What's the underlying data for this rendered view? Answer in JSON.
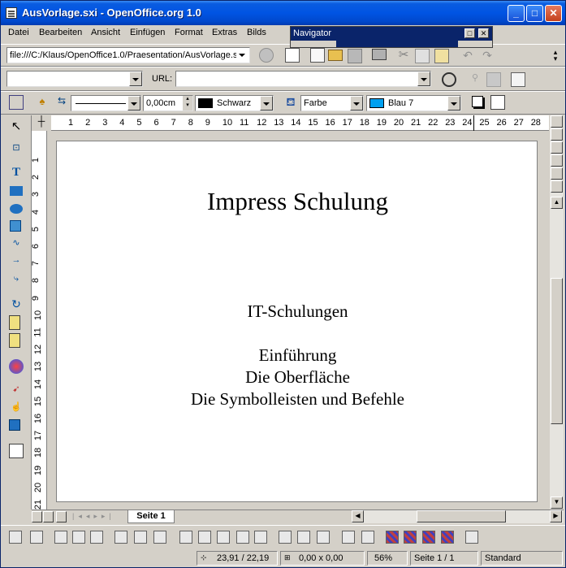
{
  "window": {
    "title": "AusVorlage.sxi - OpenOffice.org 1.0"
  },
  "menu": [
    "Datei",
    "Bearbeiten",
    "Ansicht",
    "Einfügen",
    "Format",
    "Extras",
    "Bilds"
  ],
  "navigator": {
    "title": "Navigator"
  },
  "toolbar1": {
    "path_value": "file:///C:/Klaus/OpenOffice1.0/Praesentation/AusVorlage.s"
  },
  "toolbar2": {
    "left_value": "",
    "url_label": "URL:",
    "url_value": ""
  },
  "toolbar3": {
    "line_width": "0,00cm",
    "line_color": "Schwarz",
    "area_style": "Farbe",
    "area_color": "Blau 7",
    "line_color_hex": "#000000",
    "area_color_hex": "#00a0f0"
  },
  "hruler": [
    "1",
    "2",
    "3",
    "4",
    "5",
    "6",
    "7",
    "8",
    "9",
    "10",
    "11",
    "12",
    "13",
    "14",
    "15",
    "16",
    "17",
    "18",
    "19",
    "20",
    "21",
    "22",
    "23",
    "24",
    "25",
    "26",
    "27",
    "28"
  ],
  "vruler": [
    "1",
    "2",
    "3",
    "4",
    "5",
    "6",
    "7",
    "8",
    "9",
    "10",
    "11",
    "12",
    "13",
    "14",
    "15",
    "16",
    "17",
    "18",
    "19",
    "20",
    "21"
  ],
  "slide": {
    "title": "Impress Schulung",
    "subtitle": "IT-Schulungen",
    "lines": [
      "Einführung",
      "Die Oberfläche",
      "Die Symbolleisten und Befehle"
    ]
  },
  "tab": {
    "label": "Seite 1"
  },
  "status": {
    "position": "23,91 / 22,19",
    "size": "0,00 x 0,00",
    "zoom": "56%",
    "page": "Seite 1 / 1",
    "layout": "Standard"
  }
}
